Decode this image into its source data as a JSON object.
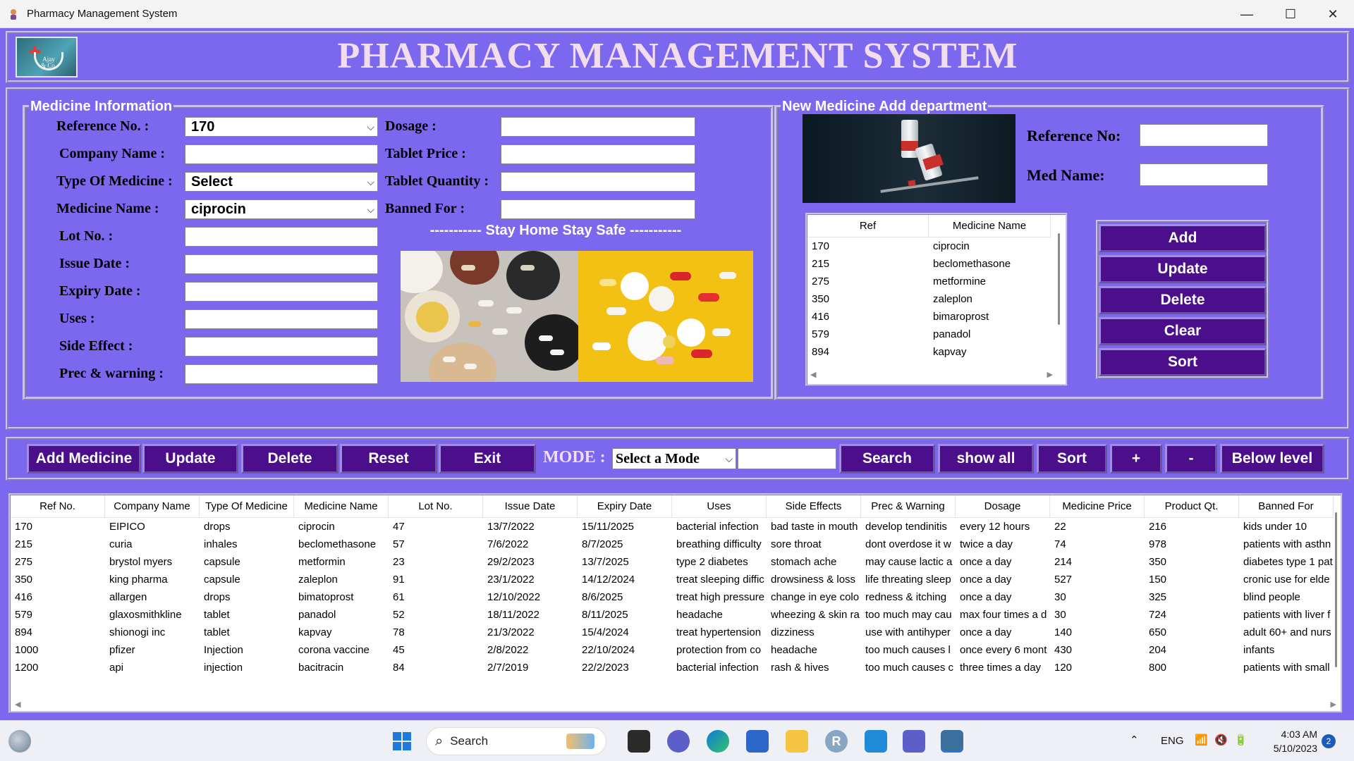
{
  "window": {
    "title": "Pharmacy Management System",
    "controls": {
      "minimize": "—",
      "maximize": "☐",
      "close": "✕"
    }
  },
  "header": {
    "title": "PHARMACY MANAGEMENT SYSTEM",
    "logo_text": "Ajay & Co."
  },
  "medicine_info": {
    "legend": "Medicine Information",
    "fields": {
      "reference_no": {
        "label": "Reference No. :",
        "value": "170"
      },
      "company_name": {
        "label": "Company Name :",
        "value": ""
      },
      "type_of_medicine": {
        "label": "Type Of Medicine :",
        "value": "Select"
      },
      "medicine_name": {
        "label": "Medicine Name :",
        "value": "ciprocin"
      },
      "lot_no": {
        "label": "Lot No. :",
        "value": ""
      },
      "issue_date": {
        "label": "Issue Date :",
        "value": ""
      },
      "expiry_date": {
        "label": "Expiry Date :",
        "value": ""
      },
      "uses": {
        "label": "Uses :",
        "value": ""
      },
      "side_effect": {
        "label": "Side Effect :",
        "value": ""
      },
      "prec_warning": {
        "label": "Prec & warning :",
        "value": ""
      },
      "dosage": {
        "label": "Dosage :",
        "value": ""
      },
      "tablet_price": {
        "label": "Tablet Price :",
        "value": ""
      },
      "tablet_quantity": {
        "label": "Tablet Quantity :",
        "value": ""
      },
      "banned_for": {
        "label": "Banned For :",
        "value": ""
      }
    },
    "slogan": "----------- Stay Home Stay Safe -----------"
  },
  "new_medicine": {
    "legend": "New Medicine Add department",
    "reference_label": "Reference No:",
    "reference_value": "",
    "med_name_label": "Med  Name:",
    "med_name_value": "",
    "table": {
      "columns": [
        "Ref",
        "Medicine Name"
      ],
      "rows": [
        [
          "170",
          "ciprocin"
        ],
        [
          "215",
          "beclomethasone"
        ],
        [
          "275",
          "metformine"
        ],
        [
          "350",
          "zaleplon"
        ],
        [
          "416",
          "bimaroprost"
        ],
        [
          "579",
          "panadol"
        ],
        [
          "894",
          "kapvay"
        ]
      ]
    },
    "buttons": [
      "Add",
      "Update",
      "Delete",
      "Clear",
      "Sort"
    ]
  },
  "toolbar": {
    "add_medicine": "Add Medicine",
    "update": "Update",
    "delete": "Delete",
    "reset": "Reset",
    "exit": "Exit",
    "mode_label": "MODE :",
    "mode_value": "Select a Mode",
    "search_value": "",
    "search": "Search",
    "show_all": "show all",
    "sort": "Sort",
    "plus": "+",
    "minus": "-",
    "below_level": "Below level"
  },
  "data_table": {
    "columns": [
      "Ref No.",
      "Company Name",
      "Type Of Medicine",
      "Medicine Name",
      "Lot No.",
      "Issue Date",
      "Expiry Date",
      "Uses",
      "Side Effects",
      "Prec & Warning",
      "Dosage",
      "Medicine Price",
      "Product Qt.",
      "Banned For"
    ],
    "rows": [
      [
        "170",
        "EIPICO",
        "drops",
        "ciprocin",
        "47",
        "13/7/2022",
        "15/11/2025",
        "bacterial infection",
        "bad taste in mouth",
        "develop tendinitis",
        "every 12 hours",
        "22",
        "216",
        "kids under 10"
      ],
      [
        "215",
        "curia",
        "inhales",
        "beclomethasone",
        "57",
        "7/6/2022",
        "8/7/2025",
        "breathing difficulty",
        "sore throat",
        "dont overdose it w",
        "twice a day",
        "74",
        "978",
        "patients with asthn"
      ],
      [
        "275",
        "brystol myers",
        "capsule",
        "metformin",
        "23",
        "29/2/2023",
        "13/7/2025",
        "type 2 diabetes",
        "stomach ache",
        "may cause lactic a",
        "once a day",
        "214",
        "350",
        "diabetes type 1 pat"
      ],
      [
        "350",
        "king pharma",
        "capsule",
        "zaleplon",
        "91",
        "23/1/2022",
        "14/12/2024",
        "treat sleeping diffic",
        "drowsiness & loss",
        "life threating sleep",
        "once a day",
        "527",
        "150",
        "cronic use for elde"
      ],
      [
        "416",
        "allargen",
        "drops",
        "bimatoprost",
        "61",
        "12/10/2022",
        "8/6/2025",
        "treat high pressure",
        "change in eye colo",
        "redness & itching",
        "once a day",
        "30",
        "325",
        "blind people"
      ],
      [
        "579",
        "glaxosmithkline",
        "tablet",
        "panadol",
        "52",
        "18/11/2022",
        "8/11/2025",
        "headache",
        "wheezing & skin ra",
        "too much may cau",
        "max four times a d",
        "30",
        "724",
        "patients with liver f"
      ],
      [
        "894",
        "shionogi inc",
        "tablet",
        "kapvay",
        "78",
        "21/3/2022",
        "15/4/2024",
        "treat hypertension",
        "dizziness",
        "use with antihyper",
        "once a day",
        "140",
        "650",
        "adult 60+ and nurs"
      ],
      [
        "1000",
        "pfizer",
        "Injection",
        "corona vaccine",
        "45",
        "2/8/2022",
        "22/10/2024",
        "protection from co",
        "headache",
        "too much causes l",
        "once every 6 mont",
        "430",
        "204",
        "infants"
      ],
      [
        "1200",
        "api",
        "injection",
        "bacitracin",
        "84",
        "2/7/2019",
        "22/2/2023",
        "bacterial infection",
        "rash & hives",
        "too much causes c",
        "three times a day",
        "120",
        "800",
        "patients with small"
      ]
    ]
  },
  "taskbar": {
    "search_label": "Search",
    "language": "ENG",
    "time": "4:03 AM",
    "date": "5/10/2023",
    "notification_count": "2"
  }
}
